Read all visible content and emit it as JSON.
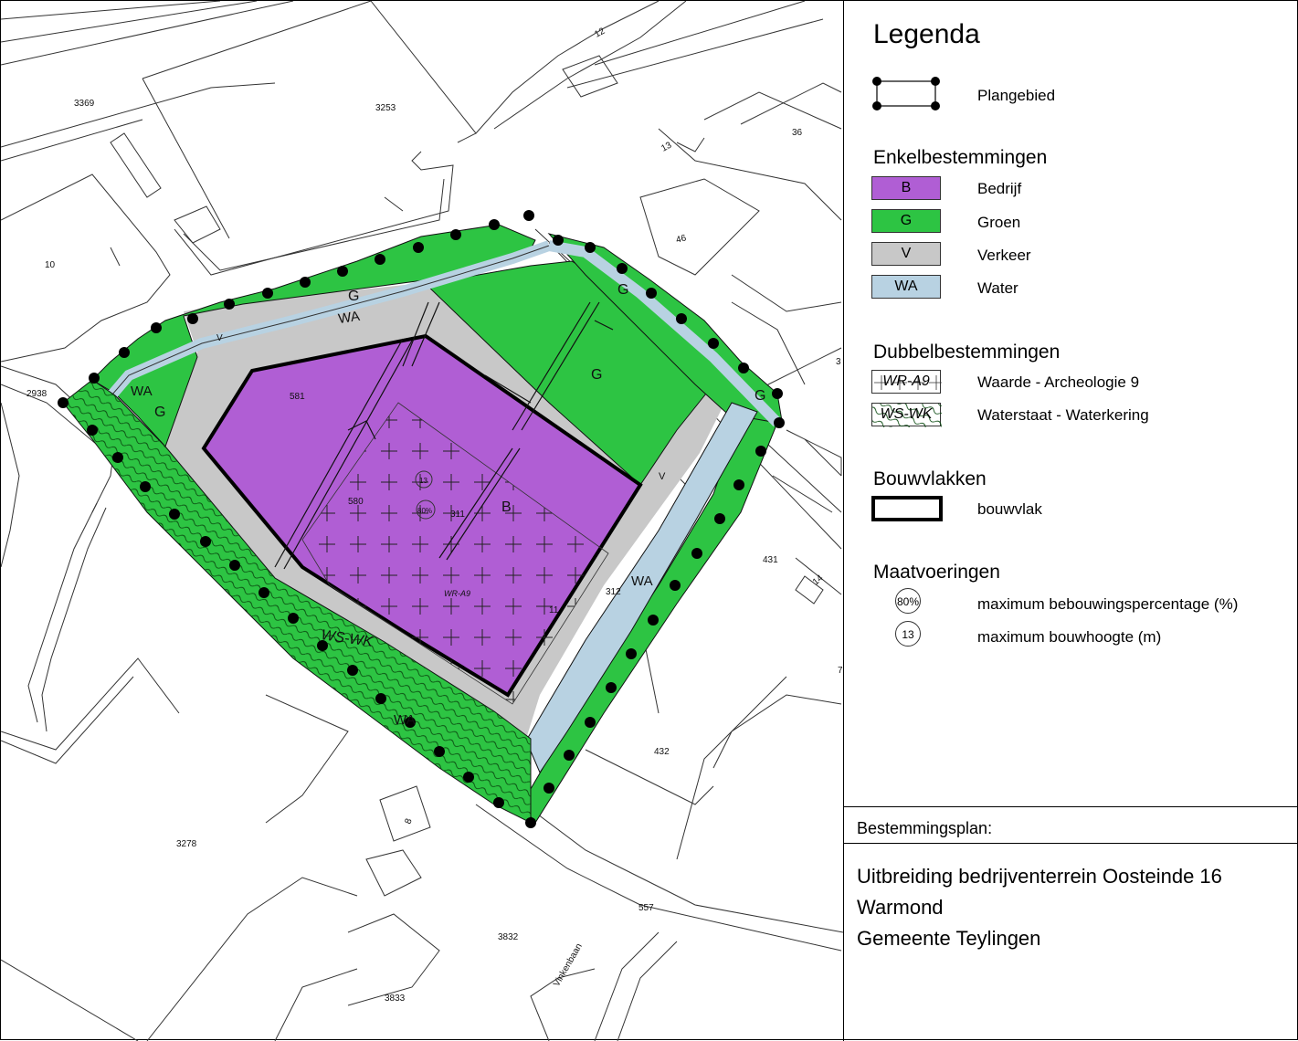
{
  "legend": {
    "title": "Legenda",
    "plangebied": "Plangebied",
    "enkel_title": "Enkelbestemmingen",
    "enkel": [
      {
        "code": "B",
        "label": "Bedrijf",
        "color": "#b05ed4"
      },
      {
        "code": "G",
        "label": "Groen",
        "color": "#2dc443"
      },
      {
        "code": "V",
        "label": "Verkeer",
        "color": "#c8c8c8"
      },
      {
        "code": "WA",
        "label": "Water",
        "color": "#b8d2e2"
      }
    ],
    "dubbel_title": "Dubbelbestemmingen",
    "dubbel": [
      {
        "code": "WR-A9",
        "label": "Waarde - Archeologie 9"
      },
      {
        "code": "WS-WK",
        "label": "Waterstaat - Waterkering"
      }
    ],
    "bouw_title": "Bouwvlakken",
    "bouwvlak": "bouwvlak",
    "maat_title": "Maatvoeringen",
    "maat": [
      {
        "code": "80%",
        "label": "maximum bebouwingspercentage (%)"
      },
      {
        "code": "13",
        "label": "maximum bouwhoogte (m)"
      }
    ]
  },
  "plan": {
    "heading": "Bestemmingsplan:",
    "lines": [
      "Uitbreiding bedrijventerrein Oosteinde 16",
      "Warmond",
      "Gemeente Teylingen"
    ]
  },
  "map": {
    "parcels": [
      "3369",
      "3253",
      "12",
      "36",
      "13",
      "10",
      "46",
      "581",
      "2938",
      "580",
      "311",
      "431",
      "14",
      "312",
      "432",
      "8",
      "3278",
      "557",
      "3832",
      "3833",
      "3",
      "7",
      "11"
    ],
    "zones": {
      "G": "G",
      "V": "V",
      "WA": "WA",
      "B": "B",
      "WR": "WR-A9",
      "WS": "WS-WK"
    },
    "bouwpercentage": "80%",
    "bouwhoogte": "13",
    "street": "Vinkenbaan"
  }
}
